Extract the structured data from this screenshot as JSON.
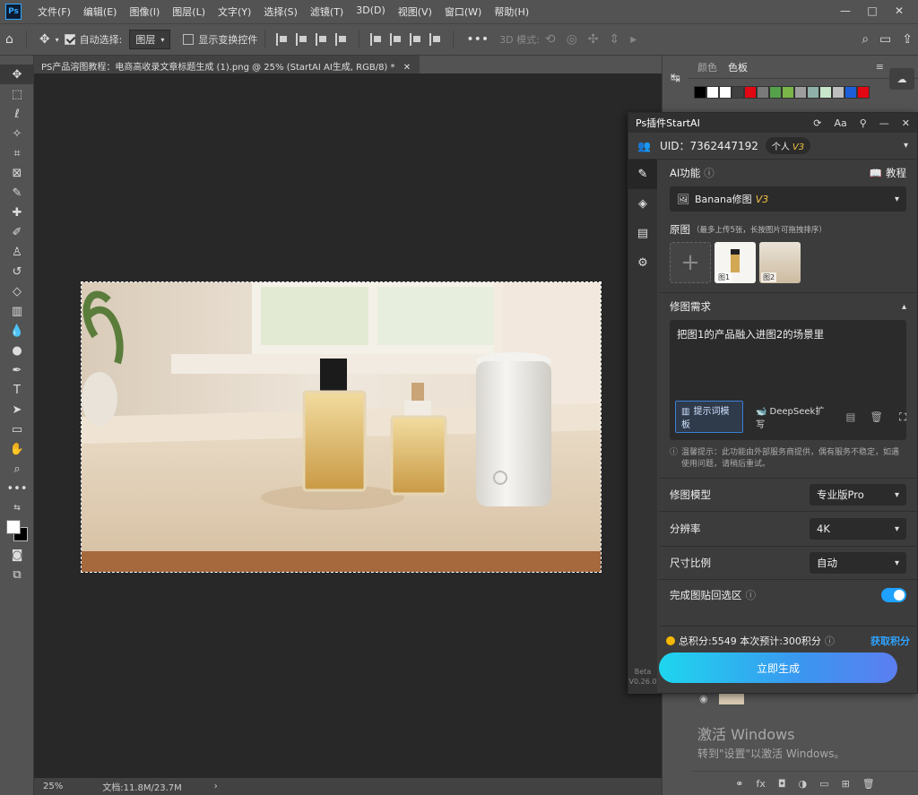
{
  "menu": [
    "文件(F)",
    "编辑(E)",
    "图像(I)",
    "图层(L)",
    "文字(Y)",
    "选择(S)",
    "滤镜(T)",
    "3D(D)",
    "视图(V)",
    "窗口(W)",
    "帮助(H)"
  ],
  "app_logo": "Ps",
  "options": {
    "auto_select_label": "自动选择:",
    "auto_select_value": "图层",
    "show_transform_label": "显示变换控件",
    "mode_3d_label": "3D 模式:"
  },
  "document": {
    "tab_title": "PS产品溶图教程：电商高收录文章标题生成 (1).png @ 25% (StartAI AI生成, RGB/8) *",
    "zoom": "25%",
    "doc_size": "文档:11.8M/23.7M"
  },
  "swatches": {
    "tab1": "颜色",
    "tab2": "色板",
    "colors": [
      "#000000",
      "#ffffff",
      "#ffffff",
      "#404040",
      "#e30613",
      "#7a7a7a",
      "#55a04a",
      "#7ab648",
      "#9e9e9e",
      "#8fb0a8",
      "#c8e6c9",
      "#bdbdbd",
      "#1b5ed8",
      "#e30613"
    ]
  },
  "plugin": {
    "title": "Ps插件StartAI",
    "uid_label": "UID：7362447192",
    "tier": "个人",
    "tier_version": "V3",
    "ai_func_label": "AI功能",
    "tutorial_label": "教程",
    "function_name": "Banana修图",
    "function_version": "V3",
    "source_label": "原图",
    "source_hint": "（最多上传5张，长按图片可拖拽排序）",
    "thumb1_label": "图1",
    "thumb2_label": "图2",
    "request_label": "修图需求",
    "request_text": "把图1的产品融入进图2的场景里",
    "template_chip": "提示词模板",
    "deepseek_chip": "DeepSeek扩写",
    "notice": "温馨提示：此功能由外部服务商提供，偶有服务不稳定，如遇使用问题，请稍后重试。",
    "model_label": "修图模型",
    "model_value": "专业版Pro",
    "resolution_label": "分辨率",
    "resolution_value": "4K",
    "ratio_label": "尺寸比例",
    "ratio_value": "自动",
    "paste_back_label": "完成图贴回选区",
    "paste_back_on": true,
    "points_text": "总积分:5549  本次预计:300积分",
    "get_points": "获取积分",
    "generate_button": "立即生成",
    "version_beta": "Beta",
    "version_num": "V0.26.0"
  },
  "watermark": {
    "line1": "激活 Windows",
    "line2": "转到\"设置\"以激活 Windows。"
  }
}
